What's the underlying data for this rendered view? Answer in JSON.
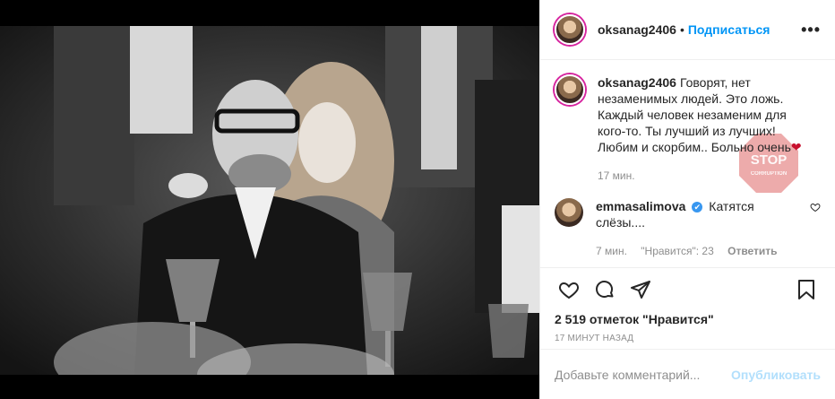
{
  "post": {
    "username": "oksanag2406",
    "follow_label": "Подписаться",
    "dot": "•",
    "more_label": "•••"
  },
  "caption": {
    "username": "oksanag2406",
    "text": "Говорят, нет незаменимых людей. Это ложь. Каждый человек незаменим для кого-то. Ты лучший из лучших! Любим и скорбим.. Больно очень",
    "emoji": "❤",
    "time": "17 мин."
  },
  "comment": {
    "username": "emmasalimova",
    "verified_mark": "✔",
    "text": "Катятся слёзы....",
    "time": "7 мин.",
    "likes": "\"Нравится\": 23",
    "reply": "Ответить"
  },
  "likes_text": "2 519 отметок \"Нравится\"",
  "time_ago": "17 МИНУТ НАЗАД",
  "add_comment": {
    "placeholder": "Добавьте комментарий...",
    "publish_label": "Опубликовать"
  },
  "watermark": {
    "line1": "STOP",
    "line2": "CORRUPTION"
  },
  "colors": {
    "accent": "#0095f6",
    "publish_disabled": "#b2dffc",
    "ring": "#d6249f"
  }
}
